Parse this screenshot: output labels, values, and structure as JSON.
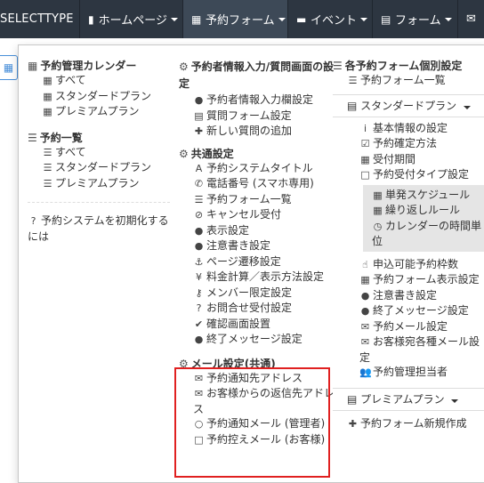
{
  "navbar": {
    "brand": "SELECTTYPE",
    "items": [
      {
        "label": "ホームページ",
        "icon": "document-icon",
        "active": false
      },
      {
        "label": "予約フォーム",
        "icon": "calendar-icon",
        "active": true
      },
      {
        "label": "イベント",
        "icon": "comment-icon",
        "active": false
      },
      {
        "label": "フォーム",
        "icon": "form-icon",
        "active": false
      },
      {
        "label": "✉",
        "icon": "mail-icon",
        "active": false
      }
    ]
  },
  "col1": {
    "calendar_head": "予約管理カレンダー",
    "calendar_items": [
      "すべて",
      "スタンダードプラン",
      "プレミアムプラン"
    ],
    "list_head": "予約一覧",
    "list_items": [
      "すべて",
      "スタンダードプラン",
      "プレミアムプラン"
    ],
    "reset_text": "予約システムを初期化するには"
  },
  "col2": {
    "reserver_head": "予約者情報入力/質問画面の設定",
    "reserver_items": [
      "予約者情報入力欄設定",
      "質問フォーム設定",
      "新しい質問の追加"
    ],
    "common_head": "共通設定",
    "common_items": [
      "予約システムタイトル",
      "電話番号 (スマホ専用)",
      "予約フォーム一覧",
      "キャンセル受付",
      "表示設定",
      "注意書き設定",
      "ページ遷移設定",
      "料金計算／表示方法設定",
      "メンバー限定設定",
      "お問合せ受付設定",
      "確認画面設置",
      "終了メッセージ設定"
    ],
    "mail_head": "メール設定(共通)",
    "mail_items": [
      "予約通知先アドレス",
      "お客様からの返信先アドレス",
      "予約通知メール (管理者)",
      "予約控えメール (お客様)"
    ]
  },
  "col3": {
    "head": "各予約フォーム個別設定",
    "form_list": "予約フォーム一覧",
    "standard_plan": "スタンダードプラン",
    "standard_items": [
      "基本情報の設定",
      "予約確定方法",
      "受付期間",
      "予約受付タイプ設定"
    ],
    "type_items": [
      "単発スケジュール",
      "繰り返しルール",
      "カレンダーの時間単位"
    ],
    "standard_items2": [
      "申込可能予約枠数",
      "予約フォーム表示設定",
      "注意書き設定",
      "終了メッセージ設定",
      "予約メール設定",
      "お客様宛各種メール設定",
      "予約管理担当者"
    ],
    "premium_plan": "プレミアムプラン",
    "new_form": "予約フォーム新規作成"
  },
  "colors": {
    "navbar": "#2d3641",
    "navbar_active": "#3d4957",
    "highlight_border": "#e02020",
    "grey_panel": "#e5e5e5"
  }
}
